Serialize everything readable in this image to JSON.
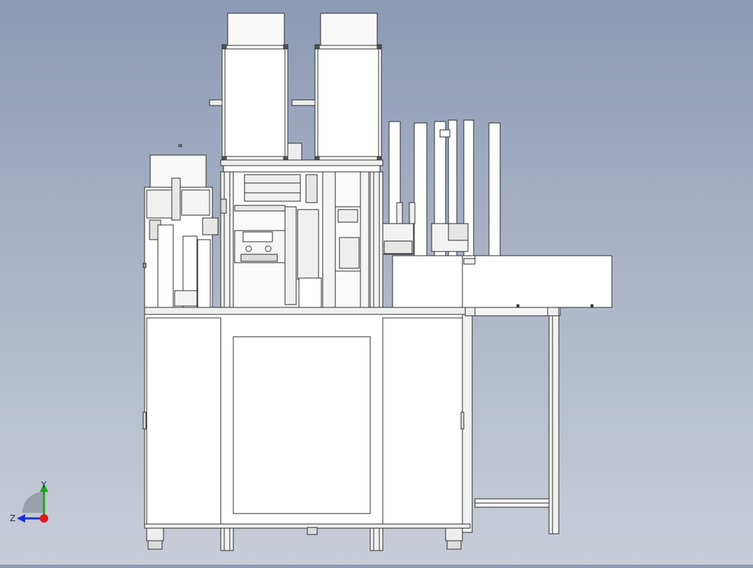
{
  "viewer": {
    "background_top": "#8b9ab3",
    "background_bottom": "#c9cdd8",
    "line_color": "#2b2b2b",
    "part_fill": "#ffffff",
    "part_shade": "#e6e6e6"
  },
  "triad": {
    "y_label": "Y",
    "z_label": "Z",
    "y_color": "#18a818",
    "z_color": "#1a2fd6",
    "x_color": "#e01818"
  }
}
